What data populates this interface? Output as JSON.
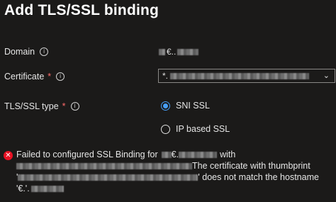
{
  "title": "Add TLS/SSL binding",
  "fields": {
    "domain": {
      "label": "Domain",
      "value": "€.."
    },
    "certificate": {
      "label": "Certificate",
      "required": "*",
      "value": "*."
    },
    "ssl_type": {
      "label": "TLS/SSL type",
      "required": "*",
      "options": [
        {
          "label": "SNI SSL",
          "selected": true
        },
        {
          "label": "IP based SSL",
          "selected": false
        }
      ]
    }
  },
  "error": {
    "line1_prefix": "Failed to configured SSL Binding for",
    "line1_domain": "€.",
    "line1_suffix": "with",
    "line2_suffix": "The certificate with thumbprint",
    "line3_prefix": "'",
    "line3_suffix": "' does not match the hostname",
    "line4_value": "'€.'."
  },
  "colors": {
    "accent": "#479ef5",
    "error": "#e81123",
    "background": "#1b1a19"
  }
}
